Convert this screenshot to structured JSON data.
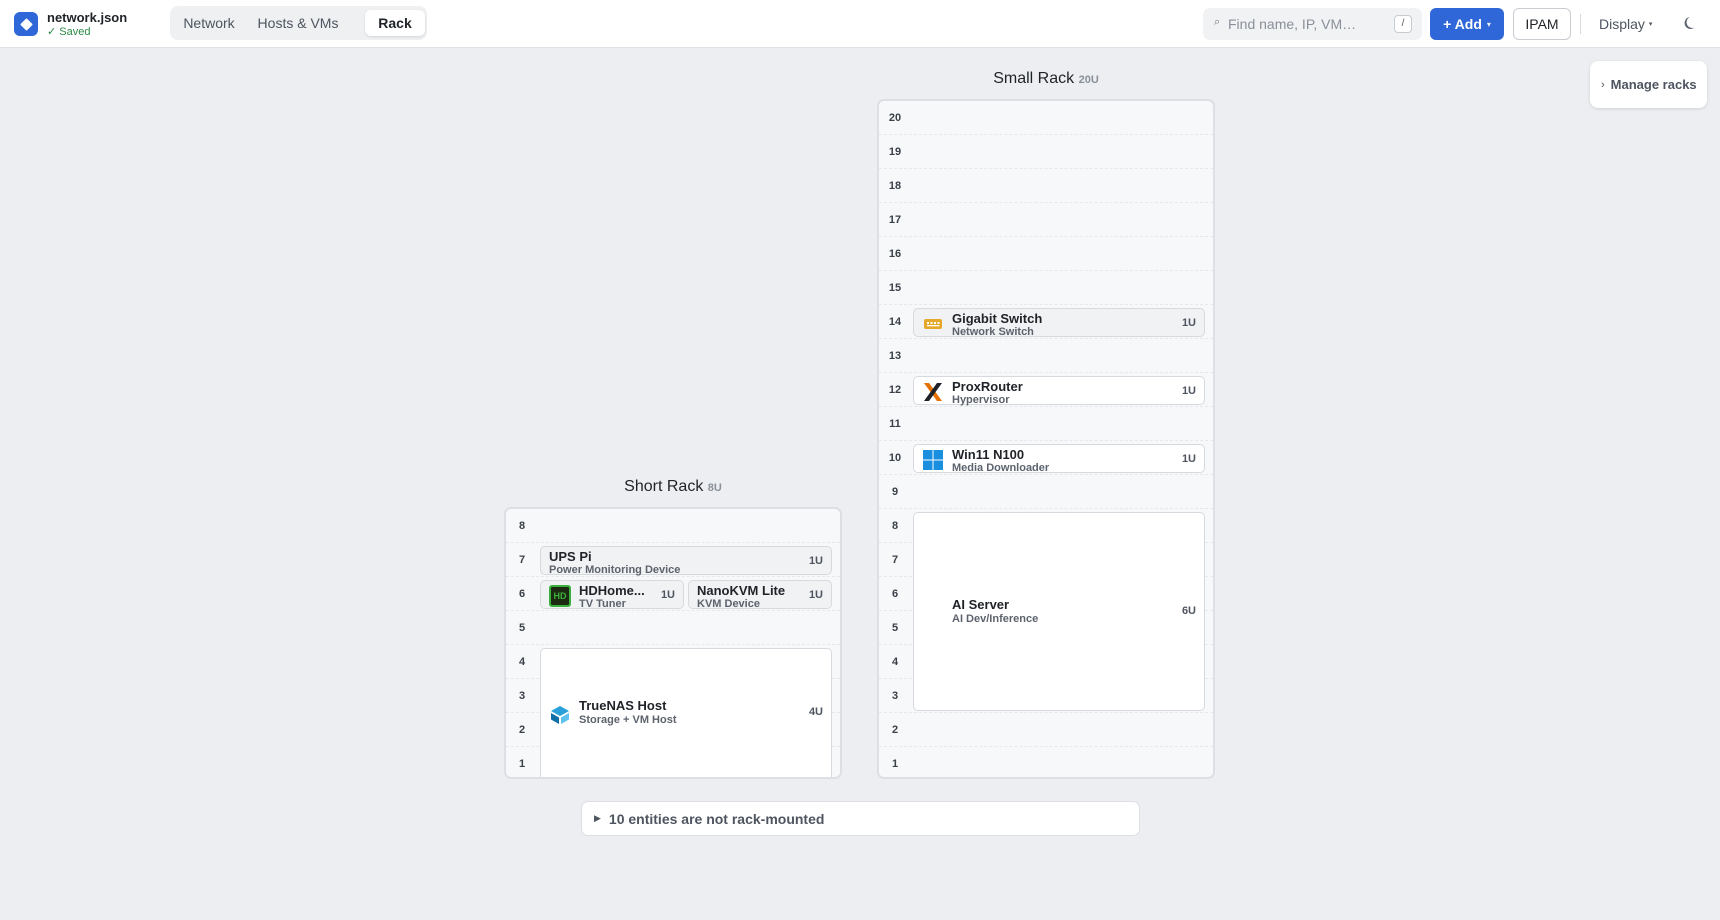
{
  "header": {
    "filename": "network.json",
    "saved": "✓ Saved",
    "tabs": [
      {
        "label": "Network"
      },
      {
        "label": "Hosts & VMs"
      },
      {
        "label": "Rack"
      }
    ],
    "active_tab": "Rack",
    "search": {
      "placeholder": "Find name, IP, VM…",
      "shortcut": "/"
    },
    "add_label": "+ Add",
    "ipam_label": "IPAM",
    "display_label": "Display"
  },
  "sidebar": {
    "manage_racks": "Manage racks"
  },
  "racks": {
    "short": {
      "name": "Short Rack",
      "size": "8U",
      "units": [
        "8",
        "7",
        "6",
        "5",
        "4",
        "3",
        "2",
        "1"
      ],
      "devices": {
        "ups": {
          "name": "UPS Pi",
          "sub": "Power Monitoring Device",
          "size": "1U"
        },
        "hdhome": {
          "name": "HDHome...",
          "sub": "TV Tuner",
          "size": "1U",
          "icon_text": "HD"
        },
        "nanokvm": {
          "name": "NanoKVM Lite",
          "sub": "KVM Device",
          "size": "1U"
        },
        "truenas": {
          "name": "TrueNAS Host",
          "sub": "Storage + VM Host",
          "size": "4U"
        }
      }
    },
    "small": {
      "name": "Small Rack",
      "size": "20U",
      "units": [
        "20",
        "19",
        "18",
        "17",
        "16",
        "15",
        "14",
        "13",
        "12",
        "11",
        "10",
        "9",
        "8",
        "7",
        "6",
        "5",
        "4",
        "3",
        "2",
        "1"
      ],
      "devices": {
        "switch": {
          "name": "Gigabit Switch",
          "sub": "Network Switch",
          "size": "1U"
        },
        "proxrouter": {
          "name": "ProxRouter",
          "sub": "Hypervisor",
          "size": "1U"
        },
        "win11": {
          "name": "Win11 N100",
          "sub": "Media Downloader",
          "size": "1U"
        },
        "aiserver": {
          "name": "AI Server",
          "sub": "AI Dev/Inference",
          "size": "6U"
        }
      }
    }
  },
  "unmounted": {
    "label": "10 entities are not rack-mounted"
  },
  "colors": {
    "accent": "#2f67d8",
    "saved": "#2a8a45",
    "hdhomerun": "#3cb03c",
    "proxmox": "#e57000",
    "windows": "#1a8fe0",
    "truenas": "#2aa0d8",
    "switch": "#e6a82a"
  }
}
